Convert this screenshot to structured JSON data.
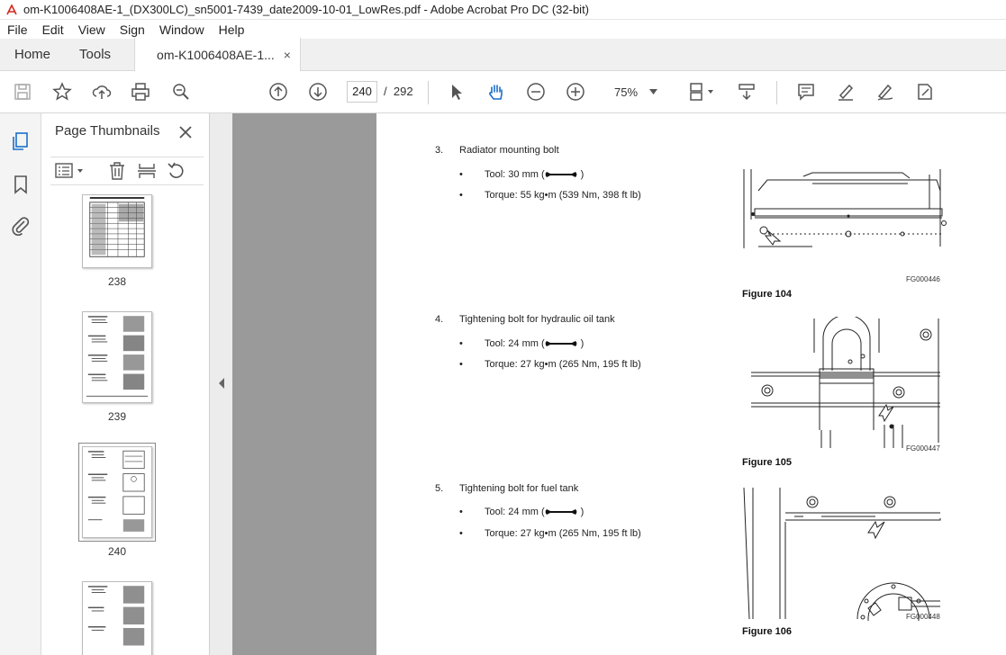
{
  "window": {
    "title": "om-K1006408AE-1_(DX300LC)_sn5001-7439_date2009-10-01_LowRes.pdf - Adobe Acrobat Pro DC (32-bit)"
  },
  "menu": [
    "File",
    "Edit",
    "View",
    "Sign",
    "Window",
    "Help"
  ],
  "tabs": {
    "home": "Home",
    "tools": "Tools",
    "doc": "om-K1006408AE-1...",
    "close": "×"
  },
  "toolbar": {
    "page_current": "240",
    "page_sep": "/",
    "page_total": "292",
    "zoom": "75%"
  },
  "panel": {
    "title": "Page Thumbnails",
    "thumbs": [
      {
        "label": "238"
      },
      {
        "label": "239"
      },
      {
        "label": "240"
      }
    ]
  },
  "document": {
    "items": [
      {
        "num": "3.",
        "title": "Radiator mounting bolt",
        "tool": "Tool: 30 mm (",
        "tool_end": ")",
        "torque": "Torque: 55 kg•m (539 Nm, 398 ft lb)",
        "fg": "FG000446",
        "figure": "Figure 104"
      },
      {
        "num": "4.",
        "title": "Tightening bolt for hydraulic oil tank",
        "tool": "Tool: 24 mm (",
        "tool_end": ")",
        "torque": "Torque: 27 kg•m (265 Nm, 195 ft lb)",
        "fg": "FG000447",
        "figure": "Figure 105"
      },
      {
        "num": "5.",
        "title": "Tightening bolt for fuel tank",
        "tool": "Tool: 24 mm (",
        "tool_end": ")",
        "torque": "Torque: 27 kg•m (265 Nm, 195 ft lb)",
        "fg": "FG000448",
        "figure": "Figure 106"
      }
    ],
    "bullet": "•"
  }
}
